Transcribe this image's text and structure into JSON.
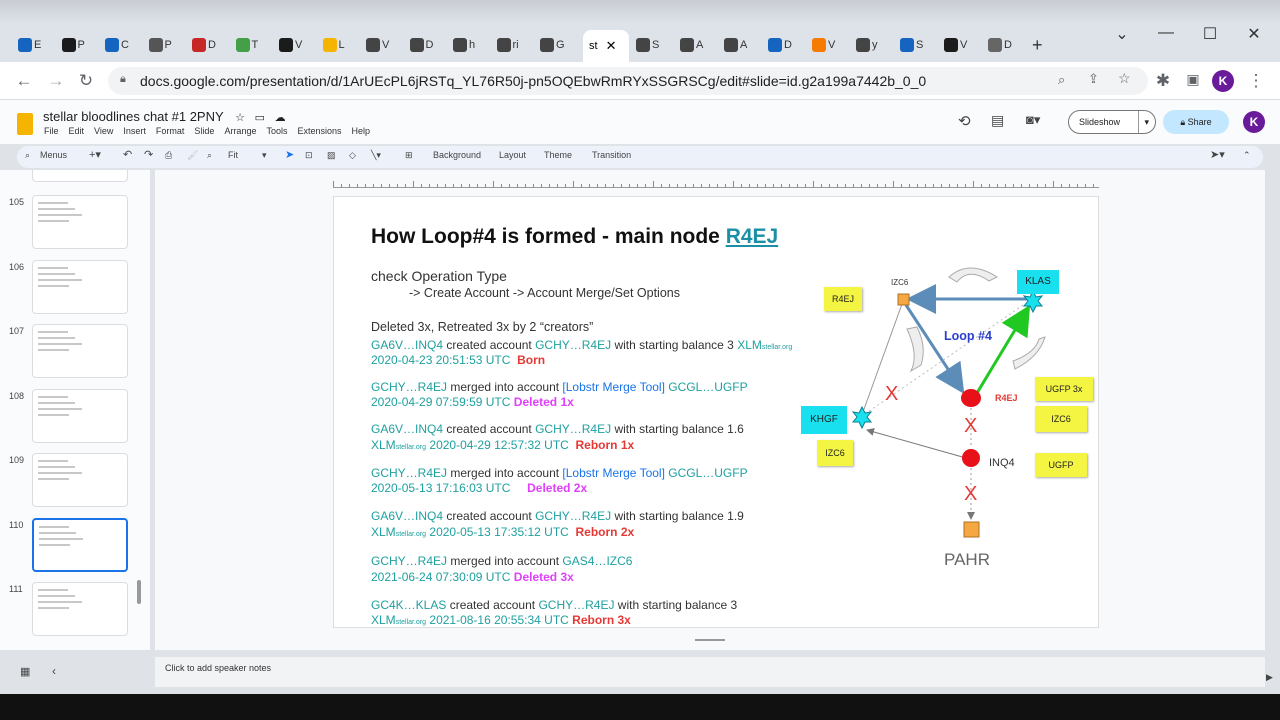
{
  "browser": {
    "tabs": [
      {
        "label": "E",
        "color": "#1565c0"
      },
      {
        "label": "P",
        "color": "#1b1b1b"
      },
      {
        "label": "C",
        "color": "#1565c0"
      },
      {
        "label": "P",
        "color": "#555555"
      },
      {
        "label": "D",
        "color": "#c62828"
      },
      {
        "label": "T",
        "color": "#43a047"
      },
      {
        "label": "V",
        "color": "#1b1b1b"
      },
      {
        "label": "L",
        "color": "#f4b400"
      },
      {
        "label": "V",
        "color": "#444444"
      },
      {
        "label": "D",
        "color": "#444444"
      },
      {
        "label": "h",
        "color": "#444444"
      },
      {
        "label": "ri",
        "color": "#444444"
      },
      {
        "label": "G",
        "color": "#444444"
      }
    ],
    "active_tab": "st",
    "tabs_right": [
      {
        "label": "S",
        "color": "#444444"
      },
      {
        "label": "A",
        "color": "#444444"
      },
      {
        "label": "A",
        "color": "#444444"
      },
      {
        "label": "D",
        "color": "#1565c0"
      },
      {
        "label": "V",
        "color": "#f57c00"
      },
      {
        "label": "y",
        "color": "#444444"
      },
      {
        "label": "S",
        "color": "#1565c0"
      },
      {
        "label": "V",
        "color": "#1b1b1b"
      },
      {
        "label": "D",
        "color": "#666666"
      }
    ],
    "new_tab": "+",
    "url": "docs.google.com/presentation/d/1ArUEcPL6jRSTq_YL76R50j-pn5OQEbwRmRYxSSGRSCg/edit#slide=id.g2a199a7442b_0_0",
    "avatar": "K"
  },
  "app": {
    "title": "stellar bloodlines chat #1 2PNY",
    "menus": [
      "File",
      "Edit",
      "View",
      "Insert",
      "Format",
      "Slide",
      "Arrange",
      "Tools",
      "Extensions",
      "Help"
    ],
    "slideshow": "Slideshow",
    "share": "Share",
    "avatar": "K"
  },
  "toolbar": {
    "menus": "Menus",
    "zoom": "Fit",
    "background": "Background",
    "layout": "Layout",
    "theme": "Theme",
    "transition": "Transition"
  },
  "slides_panel": {
    "numbers": [
      "105",
      "106",
      "107",
      "108",
      "109",
      "110",
      "111"
    ],
    "selected": "110"
  },
  "slide": {
    "title": "How Loop#4 is formed - main node ",
    "title_link": "R4EJ",
    "check": "check Operation Type",
    "check_sub": "-> Create Account -> Account Merge/Set Options",
    "deleted": "Deleted 3x, Retreated 3x by 2 “creators”",
    "lines": {
      "l1a": "GA6V…INQ4",
      "l1b": " created account ",
      "l1c": "GCHY…R4EJ",
      "l1d": " with starting balance 3 ",
      "l1e": "XLM",
      "l1f": "stellar.org",
      "l1g": "2020-04-23 20:51:53 UTC",
      "l1h": "Born",
      "l2a": "GCHY…R4EJ",
      "l2b": " merged into account ",
      "l2c": "[Lobstr Merge Tool]",
      "l2d": " GCGL…UGFP",
      "l2e": "2020-04-29 07:59:59 UTC",
      "l2f": "Deleted 1x",
      "l3a": "GA6V…INQ4",
      "l3b": " created account ",
      "l3c": "GCHY…R4EJ",
      "l3d": " with starting balance 1.6",
      "l3e": "XLM",
      "l3f": "stellar.org",
      "l3g": "2020-04-29 12:57:32 UTC",
      "l3h": "Reborn 1x",
      "l4a": "GCHY…R4EJ",
      "l4b": " merged into account ",
      "l4c": "[Lobstr Merge Tool]",
      "l4d": " GCGL…UGFP",
      "l4e": "2020-05-13 17:16:03 UTC",
      "l4f": "Deleted 2x",
      "l5a": "GA6V…INQ4",
      "l5b": " created account ",
      "l5c": "GCHY…R4EJ",
      "l5d": " with starting balance 1.9",
      "l5e": "XLM",
      "l5f": "stellar.org",
      "l5g": "2020-05-13 17:35:12 UTC",
      "l5h": "Reborn 2x",
      "l6a": "GCHY…R4EJ",
      "l6b": " merged into account ",
      "l6c": "GAS4…IZC6",
      "l6d": "2021-06-24 07:30:09 UTC",
      "l6e": "Deleted 3x",
      "l7a": "GC4K…KLAS",
      "l7b": " created account ",
      "l7c": "GCHY…R4EJ",
      "l7d": " with starting balance 3",
      "l7e": "XLM",
      "l7f": "stellar.org",
      "l7g": "2021-08-16 20:55:34 UTC",
      "l7h": "Reborn 3x"
    },
    "diagram": {
      "r4ej_note": "R4EJ",
      "izc6_top": "IZC6",
      "klas": "KLAS",
      "loop": "Loop #4",
      "r4ej_node": "R4EJ",
      "ugfp3x": "UGFP 3x",
      "izc6_note": "IZC6",
      "khgf": "KHGF",
      "izc6_left": "IZC6",
      "inq4": "INQ4",
      "ugfp": "UGFP",
      "pahr": "PAHR",
      "x": "X"
    }
  },
  "notes": "Click to add speaker notes"
}
